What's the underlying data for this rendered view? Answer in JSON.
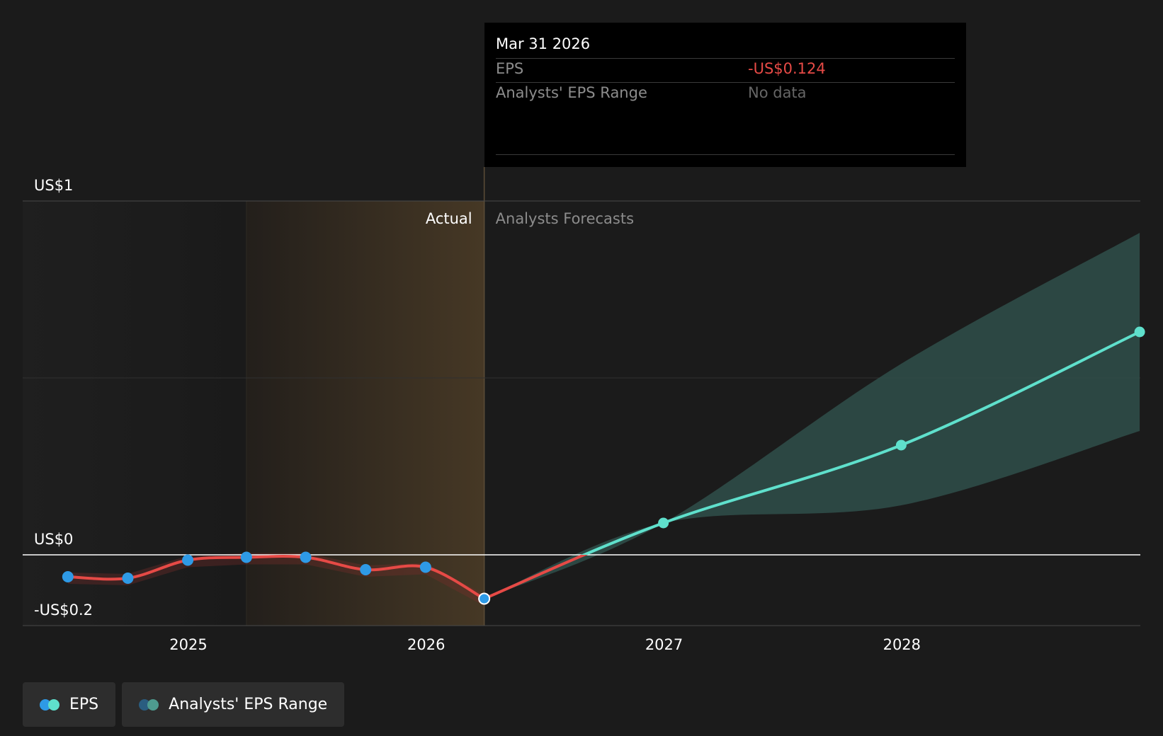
{
  "chart_data": {
    "type": "line",
    "y_axis_labels": [
      "US$1",
      "US$0",
      "-US$0.2"
    ],
    "x_tick_labels": [
      "2025",
      "2026",
      "2027",
      "2028"
    ],
    "ylim": [
      -0.2,
      1.0
    ],
    "grid": "horizontal",
    "section_labels": {
      "actual": "Actual",
      "forecast": "Analysts Forecasts"
    },
    "series": [
      {
        "name": "EPS",
        "actual_points": [
          {
            "x": "2024-06-30",
            "y": -0.062
          },
          {
            "x": "2024-09-30",
            "y": -0.066
          },
          {
            "x": "2024-12-31",
            "y": -0.015
          },
          {
            "x": "2025-03-31",
            "y": -0.007
          },
          {
            "x": "2025-06-30",
            "y": -0.007
          },
          {
            "x": "2025-09-30",
            "y": -0.042
          },
          {
            "x": "2025-12-31",
            "y": -0.035
          },
          {
            "x": "2026-03-31",
            "y": -0.124
          }
        ],
        "forecast_points": [
          {
            "x": "2026-03-31",
            "y": -0.124
          },
          {
            "x": "2026-12-31",
            "y": 0.09
          },
          {
            "x": "2027-12-31",
            "y": 0.31
          },
          {
            "x": "2028-12-31",
            "y": 0.63
          }
        ],
        "colors": {
          "actual_line": "#e64a46",
          "actual_point": "#2e9ae6",
          "forecast": "#5fe0cc"
        }
      },
      {
        "name": "Analysts' EPS Range",
        "forecast_range": [
          {
            "x": "2026-03-31",
            "low": -0.124,
            "high": -0.124
          },
          {
            "x": "2026-12-31",
            "low": 0.09,
            "high": 0.09
          },
          {
            "x": "2027-12-31",
            "low": 0.14,
            "high": 0.54
          },
          {
            "x": "2028-12-31",
            "low": 0.35,
            "high": 0.91
          }
        ],
        "color": "#2f4f4a"
      }
    ]
  },
  "tooltip": {
    "date": "Mar 31 2026",
    "rows": [
      {
        "label": "EPS",
        "value": "-US$0.124",
        "color": "#e64a46"
      },
      {
        "label": "Analysts' EPS Range",
        "value": "No data",
        "color": "#666666"
      }
    ]
  },
  "legend": [
    {
      "label": "EPS",
      "colors": [
        "#2e9ae6",
        "#5fe0cc"
      ]
    },
    {
      "label": "Analysts' EPS Range",
      "colors": [
        "#2a5d80",
        "#4e9b8f"
      ]
    }
  ]
}
